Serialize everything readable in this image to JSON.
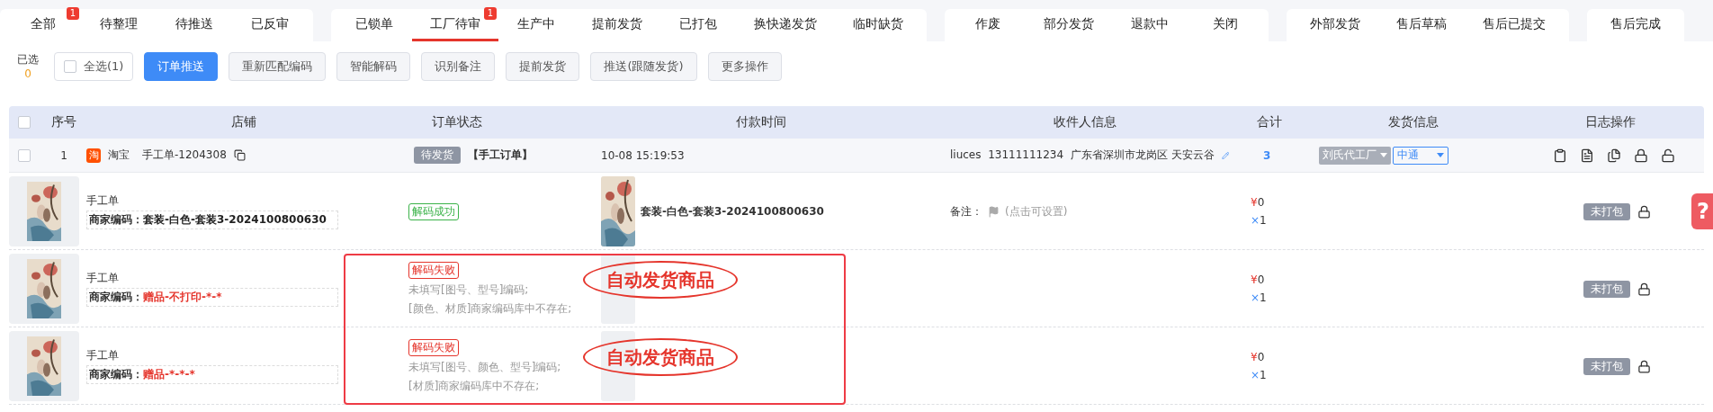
{
  "tab_groups": [
    {
      "tabs": [
        {
          "label": "全部",
          "badge": "1",
          "selected": false
        },
        {
          "label": "待整理",
          "selected": false
        },
        {
          "label": "待推送",
          "selected": false
        },
        {
          "label": "已反审",
          "selected": false
        }
      ]
    },
    {
      "tabs": [
        {
          "label": "已锁单",
          "selected": false
        },
        {
          "label": "工厂待审",
          "badge": "1",
          "selected": true
        },
        {
          "label": "生产中",
          "selected": false
        },
        {
          "label": "提前发货",
          "selected": false
        },
        {
          "label": "已打包",
          "selected": false
        },
        {
          "label": "换快递发货",
          "selected": false
        },
        {
          "label": "临时缺货",
          "selected": false
        }
      ]
    },
    {
      "tabs": [
        {
          "label": "作废",
          "selected": false
        },
        {
          "label": "部分发货",
          "selected": false
        },
        {
          "label": "退款中",
          "selected": false
        },
        {
          "label": "关闭",
          "selected": false
        }
      ]
    },
    {
      "tabs": [
        {
          "label": "外部发货",
          "selected": false
        },
        {
          "label": "售后草稿",
          "selected": false
        },
        {
          "label": "售后已提交",
          "selected": false
        }
      ]
    },
    {
      "tabs": [
        {
          "label": "售后完成",
          "selected": false
        }
      ]
    }
  ],
  "toolbar": {
    "selected_label": "已选",
    "selected_count": "0",
    "select_all": {
      "label": "全选(1)",
      "checked": false
    },
    "buttons": [
      {
        "label": "订单推送",
        "primary": true
      },
      {
        "label": "重新匹配编码",
        "primary": false
      },
      {
        "label": "智能解码",
        "primary": false
      },
      {
        "label": "识别备注",
        "primary": false
      },
      {
        "label": "提前发货",
        "primary": false
      },
      {
        "label": "推送(跟随发货)",
        "primary": false
      },
      {
        "label": "更多操作",
        "primary": false
      }
    ]
  },
  "table": {
    "header_checked": false,
    "columns": [
      "序号",
      "店铺",
      "订单状态",
      "付款时间",
      "收件人信息",
      "合计",
      "发货信息",
      "日志操作"
    ],
    "order": {
      "checked": false,
      "index": "1",
      "platform_icon": "淘",
      "platform": "淘宝",
      "order_no": "手工单-1204308",
      "status": "待发货",
      "order_type": "【手工订单】",
      "pay_time": "10-08 15:19:53",
      "recipient": "liuces  13111111234  广东省深圳市龙岗区 天安云谷",
      "total": "3",
      "factory": "刘氏代工厂",
      "express": "中通"
    },
    "items": [
      {
        "title": "手工单",
        "code_label": "商家编码：",
        "code_value": "套装-白色-套装3-2024100800630",
        "code_error": false,
        "decode": "解码成功",
        "decode_ok": true,
        "product_picture": true,
        "product_name": "套装-白色-套装3-2024100800630",
        "remark_label": "备注：",
        "remark_hint": "(点击可设置)",
        "currency": "¥",
        "price": "0",
        "qty_mark": "×",
        "qty": "1",
        "pack_status": "未打包"
      },
      {
        "title": "手工单",
        "code_label": "商家编码：",
        "code_value": "赠品-不打印-*-*",
        "code_error": true,
        "decode": "解码失败",
        "decode_ok": false,
        "messages": [
          "未填写[图号、型号]编码;",
          "[颜色、材质]商家编码库中不存在;"
        ],
        "product_picture": false,
        "annotation": "自动发货商品",
        "currency": "¥",
        "price": "0",
        "qty_mark": "×",
        "qty": "1",
        "pack_status": "未打包"
      },
      {
        "title": "手工单",
        "code_label": "商家编码：",
        "code_value": "赠品-*-*-*",
        "code_error": true,
        "decode": "解码失败",
        "decode_ok": false,
        "messages": [
          "未填写[图号、颜色、型号]编码;",
          "[材质]商家编码库中不存在;"
        ],
        "product_picture": false,
        "annotation": "自动发货商品",
        "currency": "¥",
        "price": "0",
        "qty_mark": "×",
        "qty": "1",
        "pack_status": "未打包"
      }
    ]
  },
  "help_button": "?"
}
